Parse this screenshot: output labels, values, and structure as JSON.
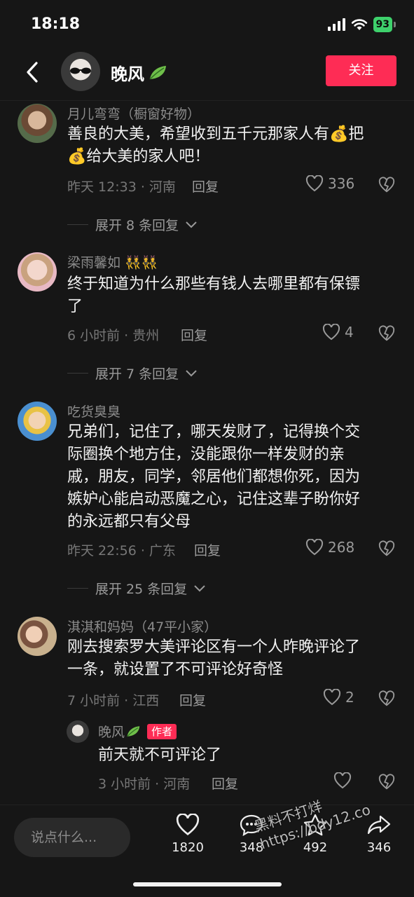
{
  "status_bar": {
    "time": "18:18",
    "battery": "93"
  },
  "header": {
    "username": "晚风",
    "follow_label": "关注"
  },
  "comments": [
    {
      "username": "月儿弯弯（橱窗好物）",
      "text_line1": "善良的大美，希望收到五千元那家人有💰把",
      "text_line2": "💰给大美的家人吧！",
      "meta": "昨天 12:33 · 河南",
      "reply_label": "回复",
      "likes": "336",
      "expand_label": "展开 8 条回复"
    },
    {
      "username": "梁雨馨如",
      "username_emoji": "👯👯",
      "text_line1": "终于知道为什么那些有钱人去哪里都有保镖",
      "text_line2": "了",
      "meta": "6 小时前 · 贵州",
      "reply_label": "回复",
      "likes": "4",
      "expand_label": "展开 7 条回复"
    },
    {
      "username": "吃货臭臭",
      "text_line1": "兄弟们，记住了，哪天发财了，记得换个交",
      "text_line2": "际圈换个地方住，没能跟你一样发财的亲",
      "text_line3": "戚，朋友，同学，邻居他们都想你死，因为",
      "text_line4": "嫉妒心能启动恶魔之心，记住这辈子盼你好",
      "text_line5": "的永远都只有父母",
      "meta": "昨天 22:56 · 广东",
      "reply_label": "回复",
      "likes": "268",
      "expand_label": "展开 25 条回复"
    },
    {
      "username": "淇淇和妈妈（47平小家）",
      "text_line1": "刚去搜索罗大美评论区有一个人昨晚评论了",
      "text_line2": "一条，就设置了不可评论好奇怪",
      "meta": "7 小时前 · 江西",
      "reply_label": "回复",
      "likes": "2"
    }
  ],
  "author_reply": {
    "username": "晚风",
    "badge": "作者",
    "text": "前天就不可评论了",
    "meta": "3 小时前 · 河南",
    "reply_label": "回复"
  },
  "bottom": {
    "input_placeholder": "说点什么...",
    "likes": "1820",
    "comments": "348",
    "favorites": "492",
    "shares": "346"
  },
  "watermark": {
    "line1": "黑料不打烊",
    "line2": "https://bdy12.co"
  },
  "colors": {
    "accent": "#fe2c55",
    "background": "#161616",
    "leaf": "#6fbf4a"
  }
}
